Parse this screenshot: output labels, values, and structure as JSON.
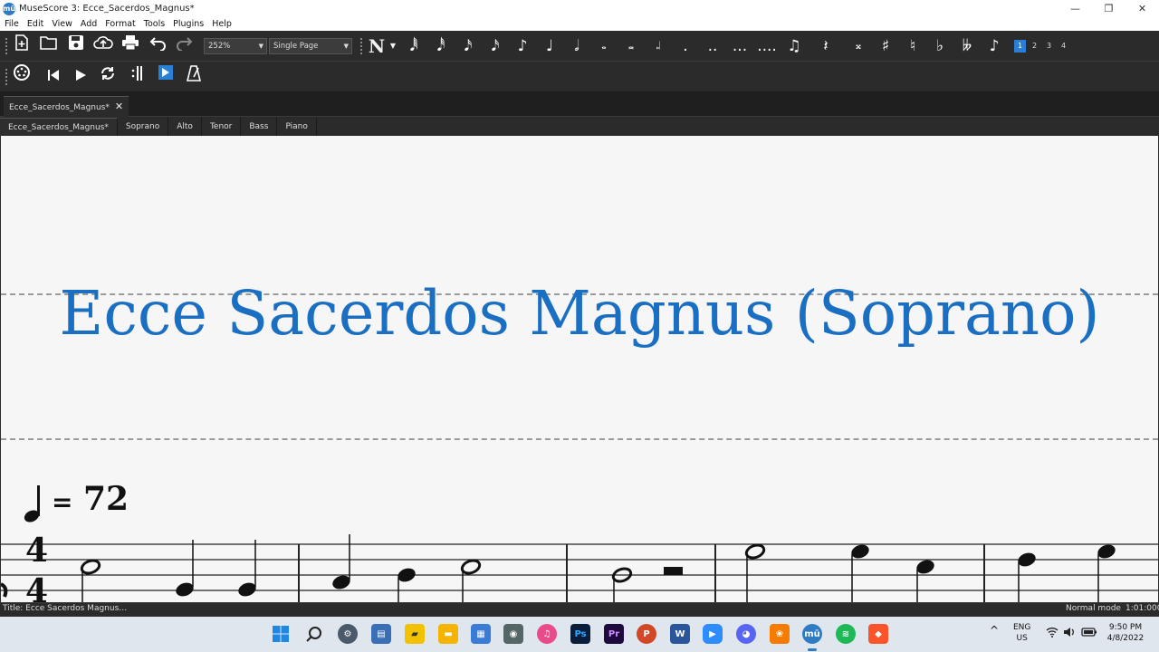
{
  "window": {
    "title": "MuseScore 3: Ecce_Sacerdos_Magnus*",
    "app_icon_label": "mū",
    "minimize": "—",
    "maximize": "❐",
    "close": "✕"
  },
  "menu": {
    "items": [
      "File",
      "Edit",
      "View",
      "Add",
      "Format",
      "Tools",
      "Plugins",
      "Help"
    ]
  },
  "toolbar": {
    "zoom": "252%",
    "view_mode": "Single Page",
    "note_input_label": "N",
    "voices": [
      "1",
      "2",
      "3",
      "4"
    ],
    "active_voice": "1"
  },
  "document_tab": {
    "label": "Ecce_Sacerdos_Magnus*",
    "close": "✕"
  },
  "part_tabs": [
    "Ecce_Sacerdos_Magnus*",
    "Soprano",
    "Alto",
    "Tenor",
    "Bass",
    "Piano"
  ],
  "score": {
    "title": "Ecce Sacerdos Magnus (Soprano)",
    "tempo_equals": "=",
    "tempo_value": "72",
    "time_signature_top": "4",
    "time_signature_bottom": "4"
  },
  "status": {
    "left": "Title: Ecce Sacerdos Magnus…",
    "mode": "Normal mode",
    "position": "1:01:000"
  },
  "taskbar": {
    "language": "ENG",
    "region": "US",
    "time": "9:50 PM",
    "date": "4/8/2022",
    "apps": [
      "start",
      "search",
      "settings",
      "store",
      "sticky-notes",
      "file-explorer",
      "calculator",
      "camera",
      "itunes",
      "photoshop",
      "premiere",
      "powerpoint",
      "word",
      "zoom",
      "discord",
      "fl-studio",
      "musescore",
      "spotify",
      "brave"
    ]
  },
  "colors": {
    "title_blue": "#1b6fc2",
    "active_voice": "#2a7fd4"
  }
}
